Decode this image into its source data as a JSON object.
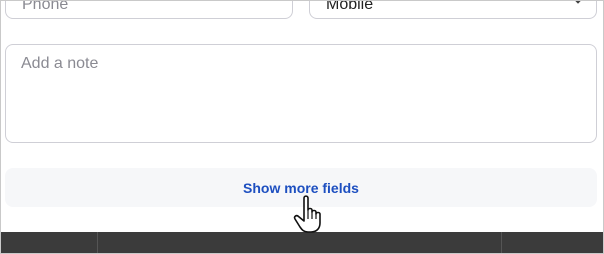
{
  "form": {
    "phone_placeholder": "Phone",
    "phone_type_value": "Mobile",
    "note_placeholder": "Add a note",
    "note_value": "",
    "show_more_label": "Show more fields"
  },
  "colors": {
    "link_blue": "#1d4fc0",
    "button_bg": "#f6f7f9",
    "border": "#cfcfd6",
    "bottom_bar": "#3b3b3b"
  },
  "icons": {
    "cursor": "hand-pointer-icon",
    "select_chevron": "chevron-down-icon"
  }
}
